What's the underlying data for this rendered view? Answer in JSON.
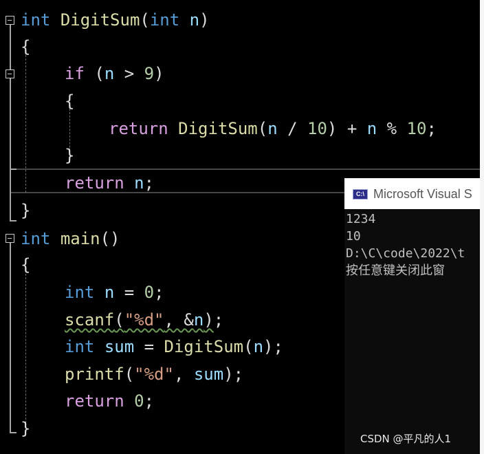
{
  "editor": {
    "lines": [
      {
        "tokens": [
          {
            "t": "int",
            "c": "kw"
          },
          {
            "t": " ",
            "c": "plain"
          },
          {
            "t": "DigitSum",
            "c": "fn"
          },
          {
            "t": "(",
            "c": "plain"
          },
          {
            "t": "int",
            "c": "kw"
          },
          {
            "t": " ",
            "c": "plain"
          },
          {
            "t": "n",
            "c": "var"
          },
          {
            "t": ")",
            "c": "plain"
          }
        ]
      },
      {
        "tokens": [
          {
            "t": "{",
            "c": "plain"
          }
        ]
      },
      {
        "tokens": [
          {
            "t": "if",
            "c": "ctl"
          },
          {
            "t": " (",
            "c": "plain"
          },
          {
            "t": "n",
            "c": "var"
          },
          {
            "t": " > ",
            "c": "plain"
          },
          {
            "t": "9",
            "c": "num"
          },
          {
            "t": ")",
            "c": "plain"
          }
        ]
      },
      {
        "tokens": [
          {
            "t": "{",
            "c": "plain"
          }
        ]
      },
      {
        "tokens": [
          {
            "t": "return",
            "c": "ctl"
          },
          {
            "t": " ",
            "c": "plain"
          },
          {
            "t": "DigitSum",
            "c": "fn"
          },
          {
            "t": "(",
            "c": "plain"
          },
          {
            "t": "n",
            "c": "var"
          },
          {
            "t": " / ",
            "c": "plain"
          },
          {
            "t": "10",
            "c": "num"
          },
          {
            "t": ") + ",
            "c": "plain"
          },
          {
            "t": "n",
            "c": "var"
          },
          {
            "t": " % ",
            "c": "plain"
          },
          {
            "t": "10",
            "c": "num"
          },
          {
            "t": ";",
            "c": "plain"
          }
        ]
      },
      {
        "tokens": [
          {
            "t": "}",
            "c": "plain"
          }
        ]
      },
      {
        "tokens": [
          {
            "t": "return",
            "c": "ctl"
          },
          {
            "t": " ",
            "c": "plain"
          },
          {
            "t": "n",
            "c": "var"
          },
          {
            "t": ";",
            "c": "plain"
          }
        ]
      },
      {
        "tokens": [
          {
            "t": "}",
            "c": "plain"
          }
        ]
      },
      {
        "tokens": [
          {
            "t": "int",
            "c": "kw"
          },
          {
            "t": " ",
            "c": "plain"
          },
          {
            "t": "main",
            "c": "fn"
          },
          {
            "t": "()",
            "c": "plain"
          }
        ]
      },
      {
        "tokens": [
          {
            "t": "{",
            "c": "plain"
          }
        ]
      },
      {
        "tokens": [
          {
            "t": "int",
            "c": "kw"
          },
          {
            "t": " ",
            "c": "plain"
          },
          {
            "t": "n",
            "c": "var"
          },
          {
            "t": " = ",
            "c": "plain"
          },
          {
            "t": "0",
            "c": "num"
          },
          {
            "t": ";",
            "c": "plain"
          }
        ]
      },
      {
        "tokens": [
          {
            "t": "scanf",
            "c": "fn squiggle"
          },
          {
            "t": "(",
            "c": "plain squiggle"
          },
          {
            "t": "\"%d\"",
            "c": "str squiggle"
          },
          {
            "t": ", &",
            "c": "plain squiggle"
          },
          {
            "t": "n",
            "c": "var squiggle"
          },
          {
            "t": ")",
            "c": "plain squiggle"
          },
          {
            "t": ";",
            "c": "plain"
          }
        ]
      },
      {
        "tokens": [
          {
            "t": "int",
            "c": "kw"
          },
          {
            "t": " ",
            "c": "plain"
          },
          {
            "t": "sum",
            "c": "var"
          },
          {
            "t": " = ",
            "c": "plain"
          },
          {
            "t": "DigitSum",
            "c": "fn"
          },
          {
            "t": "(",
            "c": "plain"
          },
          {
            "t": "n",
            "c": "var"
          },
          {
            "t": ");",
            "c": "plain"
          }
        ]
      },
      {
        "tokens": [
          {
            "t": "printf",
            "c": "fn"
          },
          {
            "t": "(",
            "c": "plain"
          },
          {
            "t": "\"%d\"",
            "c": "str"
          },
          {
            "t": ", ",
            "c": "plain"
          },
          {
            "t": "sum",
            "c": "var"
          },
          {
            "t": ");",
            "c": "plain"
          }
        ]
      },
      {
        "tokens": [
          {
            "t": "return",
            "c": "ctl"
          },
          {
            "t": " ",
            "c": "plain"
          },
          {
            "t": "0",
            "c": "num"
          },
          {
            "t": ";",
            "c": "plain"
          }
        ]
      },
      {
        "tokens": [
          {
            "t": "}",
            "c": "plain"
          }
        ]
      }
    ]
  },
  "console": {
    "icon_text": "C:\\",
    "title": "Microsoft Visual S",
    "output_lines": [
      "1234",
      "10",
      "D:\\C\\code\\2022\\t",
      "按任意键关闭此窗"
    ]
  },
  "watermark": "CSDN @平凡的人1",
  "colors": {
    "keyword": "#569cd6",
    "control": "#d8a0df",
    "function": "#dcdcaa",
    "variable": "#9cdcfe",
    "string": "#d69d85",
    "number": "#b5cea8",
    "text": "#dcdcdc",
    "background": "#000000"
  }
}
